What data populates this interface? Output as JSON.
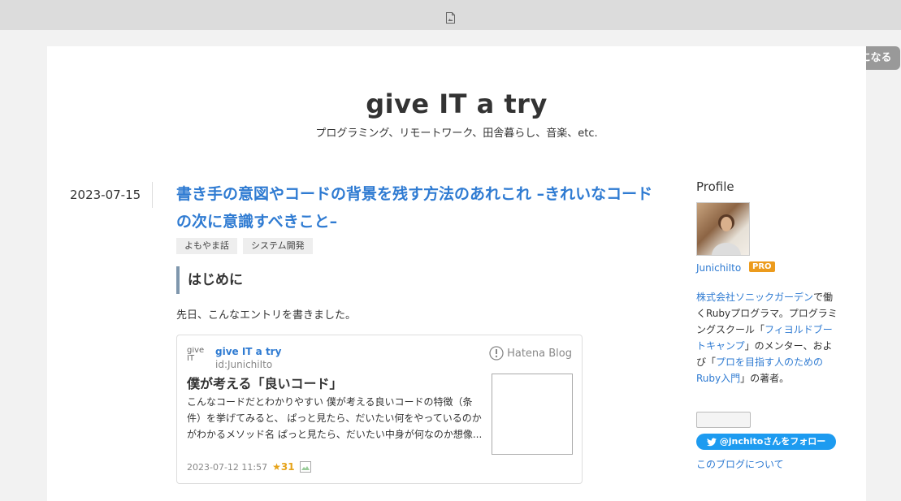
{
  "topbar": {
    "icon": "document-icon"
  },
  "follow_button": {
    "label": "読者になる"
  },
  "blog": {
    "title": "give IT a try",
    "description": "プログラミング、リモートワーク、田舎暮らし、音楽、etc."
  },
  "entry": {
    "date": "2023-07-15",
    "title": "書き手の意図やコードの背景を残す方法のあれこれ –きれいなコードの次に意識すべきこと–",
    "categories": [
      "よもやま話",
      "システム開発"
    ],
    "section_heading": "はじめに",
    "paragraph": "先日、こんなエントリを書きました。"
  },
  "embed": {
    "favicon_alt": "give IT",
    "blog_name": "give IT a try",
    "user_id": "id:JunichiIto",
    "service": "Hatena Blog",
    "title": "僕が考える「良いコード」",
    "excerpt": "こんなコードだとわかりやすい 僕が考える良いコードの特徴（条件）を挙げてみると、 ぱっと見たら、だいたい何をやっているのかがわかるメソッド名 ぱっと見たら、だいたい中身が何なのか想像...",
    "datetime": "2023-07-12 11:57",
    "stars": "★31"
  },
  "sidebar": {
    "profile_heading": "Profile",
    "profile_name": "JunichiIto",
    "pro_badge": "PRO",
    "desc": {
      "company_link": "株式会社ソニックガーデン",
      "t1": "で働くRubyプログラマ。プログラミングスクール「",
      "school_link": "フィヨルドブートキャンプ",
      "t2": "」のメンター、および「",
      "book_link": "プロを目指す人のためのRuby入門",
      "t3": "」の著者。"
    },
    "twitter_follow": "@jnchitoさんをフォロー",
    "about_link": "このブログについて"
  },
  "colors": {
    "link": "#2f7bd2",
    "pro_badge": "#ec9b1d",
    "twitter": "#1d9bf0"
  }
}
